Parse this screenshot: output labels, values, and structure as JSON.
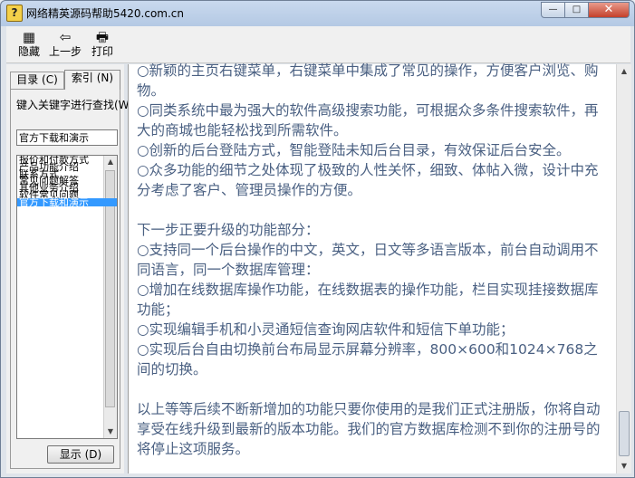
{
  "window": {
    "title": "网络精英源码帮助5420.com.cn",
    "icon": "help-question-icon",
    "controls": {
      "minimize": "—",
      "maximize": "□",
      "close": "✕"
    }
  },
  "toolbar": {
    "hide_label": "隐藏",
    "back_label": "上一步",
    "print_label": "打印",
    "hide_icon": "▦",
    "back_icon": "⇦",
    "print_icon": "🖶"
  },
  "sidebar": {
    "tabs": [
      {
        "label": "目录 (C)"
      },
      {
        "label": "索引 (N)"
      }
    ],
    "keyword_label": "键入关键字进行查找(W)",
    "keyword_value": "官方下载和演示",
    "items": [
      {
        "label": "报价和付款方式"
      },
      {
        "label": "产品功能介绍"
      },
      {
        "label": "联系方式"
      },
      {
        "label": "常见问题解答"
      },
      {
        "label": "其他业务介绍"
      },
      {
        "label": "软件常见问题"
      },
      {
        "label": "官方下载和演示"
      }
    ],
    "selected_index": 6,
    "show_button": "显示 (D)"
  },
  "content": {
    "paragraphs": [
      "○新颖的主页右键菜单，右键菜单中集成了常见的操作，方便客户浏览、购物。",
      "○同类系统中最为强大的软件高级搜索功能，可根据众多条件搜索软件，再大的商城也能轻松找到所需软件。",
      "○创新的后台登陆方式，智能登陆未知后台目录，有效保证后台安全。",
      "○众多功能的细节之处体现了极致的人性关怀，细致、体帖入微，设计中充分考虑了客户、管理员操作的方便。",
      "",
      "下一步正要升级的功能部分：",
      "○支持同一个后台操作的中文，英文，日文等多语言版本，前台自动调用不同语言，同一个数据库管理：",
      "○增加在线数据库操作功能，在线数据表的操作功能，栏目实现挂接数据库功能；",
      "○实现编辑手机和小灵通短信查询网店软件和短信下单功能；",
      "○实现后台自由切换前台布局显示屏幕分辨率，800×600和1024×768之间的切换。",
      "",
      "以上等等后续不断新增加的功能只要你使用的是我们正式注册版，你将自动享受在线升级到最新的版本功能。我们的官方数据库检测不到你的注册号的将停止这项服务。"
    ]
  },
  "scrollbars": {
    "up_arrow": "▲",
    "down_arrow": "▼"
  }
}
